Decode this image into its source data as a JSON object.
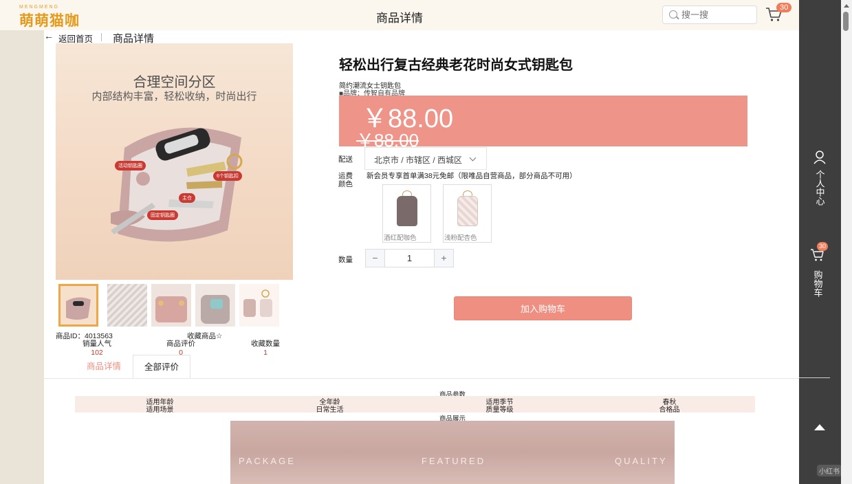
{
  "header": {
    "logo_small": "MENGMENG",
    "logo_main": "萌萌猫咖",
    "title": "商品详情",
    "search_placeholder": "搜一搜",
    "cart_count": "30"
  },
  "breadcrumb": {
    "back": "返回首页",
    "current": "商品详情"
  },
  "gallery": {
    "main_title": "合理空间分区",
    "main_sub": "内部结构丰富，轻松收纳，时尚出行",
    "tags": [
      "活动钥匙圈",
      "6个钥匙扣",
      "主仓",
      "固定钥匙圈"
    ]
  },
  "stats": {
    "product_id": "商品ID：4013563",
    "favorite": "收藏商品☆",
    "sales_label": "销量人气",
    "sales_value": "102",
    "reviews_label": "商品评价",
    "reviews_value": "0",
    "fav_count_label": "收藏数量",
    "fav_count_value": "1"
  },
  "product": {
    "title": "轻松出行复古经典老花时尚女式钥匙包",
    "subtitle": "简约潮流女士钥匙包",
    "brand": "■品牌：传智自有品牌",
    "price": "￥88.00",
    "original_price": "￥88.00",
    "shipping_label": "配送",
    "shipping_value": "北京市 / 市辖区 / 西城区",
    "fee_label": "运费",
    "fee_text": "新会员专享首单满38元免邮（限唯品自营商品，部分商品不可用）",
    "color_label": "颜色",
    "colors": [
      {
        "name": "酒红配咖色",
        "color": "#7a6a6a"
      },
      {
        "name": "浅粉配杏色",
        "color": "#e8d6d2"
      }
    ],
    "qty_label": "数量",
    "qty_value": "1",
    "add_to_cart": "加入购物车"
  },
  "tabs": [
    "商品详情",
    "全部评价"
  ],
  "params": {
    "title": "商品参数",
    "rows": [
      [
        "适用年龄",
        "全年龄",
        "适用季节",
        "春秋"
      ],
      [
        "适用场景",
        "日常生活",
        "质量等级",
        "合格品"
      ]
    ],
    "show_title": "商品展示"
  },
  "banner": {
    "words": [
      "PACKAGE",
      "FEATURED",
      "QUALITY"
    ]
  },
  "sidebar": {
    "user_label": "个人中心",
    "cart_label": "购物车",
    "cart_count": "30"
  },
  "watermark": "小红书",
  "colors": {
    "accent": "#ef8f82",
    "price_bg": "#ef9488",
    "header_bg": "#fbf7ee",
    "side_panel": "#3e3e3e"
  }
}
